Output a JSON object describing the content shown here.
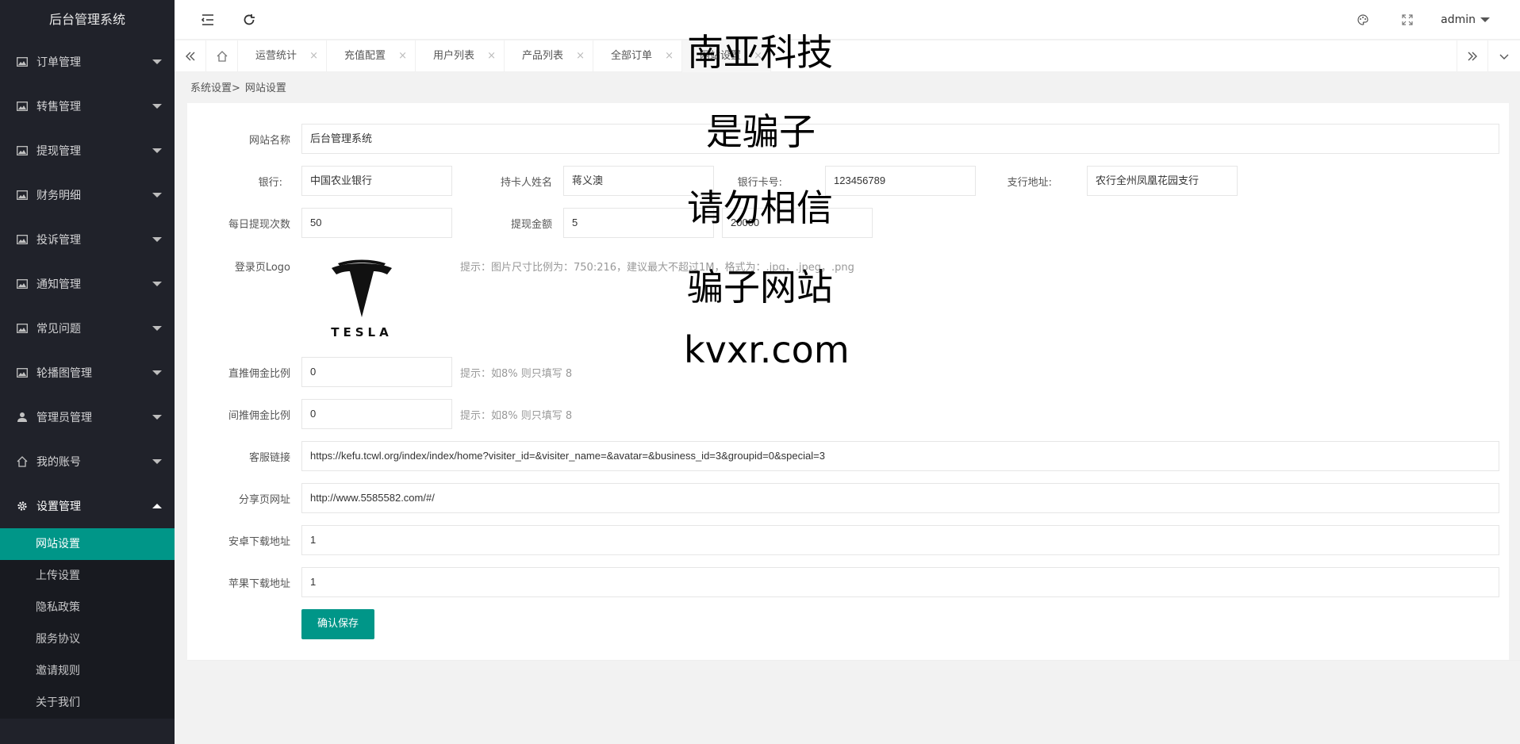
{
  "sidebar": {
    "brand": "后台管理系统",
    "items": [
      {
        "label": "订单管理",
        "icon": "image-icon"
      },
      {
        "label": "转售管理",
        "icon": "image-icon"
      },
      {
        "label": "提现管理",
        "icon": "image-icon"
      },
      {
        "label": "财务明细",
        "icon": "image-icon"
      },
      {
        "label": "投诉管理",
        "icon": "image-icon"
      },
      {
        "label": "通知管理",
        "icon": "image-icon"
      },
      {
        "label": "常见问题",
        "icon": "image-icon"
      },
      {
        "label": "轮播图管理",
        "icon": "image-icon"
      },
      {
        "label": "管理员管理",
        "icon": "user-icon"
      },
      {
        "label": "我的账号",
        "icon": "home-icon"
      },
      {
        "label": "设置管理",
        "icon": "gear-icon"
      }
    ],
    "subitems": [
      "网站设置",
      "上传设置",
      "隐私政策",
      "服务协议",
      "邀请规则",
      "关于我们"
    ]
  },
  "header": {
    "user": "admin"
  },
  "tabs": [
    "运营统计",
    "充值配置",
    "用户列表",
    "产品列表",
    "全部订单",
    "网站设置"
  ],
  "breadcrumb": {
    "parent": "系统设置>",
    "current": "网站设置"
  },
  "form": {
    "site_name_label": "网站名称",
    "site_name": "后台管理系统",
    "bank_label": "银行:",
    "bank": "中国农业银行",
    "holder_label": "持卡人姓名",
    "holder": "蒋义澳",
    "card_label": "银行卡号:",
    "card": "123456789",
    "branch_label": "支行地址:",
    "branch": "农行全州凤凰花园支行",
    "daily_label": "每日提现次数",
    "daily": "50",
    "amount_label": "提现金额",
    "amount_min": "5",
    "amount_max": "20000",
    "logo_label": "登录页Logo",
    "logo_text": "TESLA",
    "logo_tip": "提示：图片尺寸比例为：750:216，建议最大不超过1M，格式为：.jpg，.jpeg，.png",
    "direct_label": "直推佣金比例",
    "direct": "0",
    "direct_tip": "提示：如8% 则只填写 8",
    "indirect_label": "间推佣金比例",
    "indirect": "0",
    "indirect_tip": "提示：如8% 则只填写 8",
    "service_label": "客服链接",
    "service": "https://kefu.tcwl.org/index/index/home?visiter_id=&visiter_name=&avatar=&business_id=3&groupid=0&special=3",
    "share_label": "分享页网址",
    "share": "http://www.5585582.com/#/",
    "android_label": "安卓下载地址",
    "android": "1",
    "ios_label": "苹果下载地址",
    "ios": "1",
    "save": "确认保存"
  },
  "overlay": [
    "南亚科技",
    "是骗子",
    "请勿相信",
    "骗子网站",
    "kvxr.com"
  ],
  "colors": {
    "sidebar_bg": "#20222a",
    "accent": "#009688"
  }
}
